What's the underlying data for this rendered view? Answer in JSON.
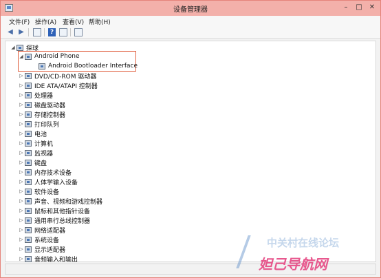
{
  "window": {
    "title": "设备管理器",
    "controls": [
      "–",
      "□",
      "✕"
    ]
  },
  "menu": [
    "文件(F)",
    "操作(A)",
    "查看(V)",
    "帮助(H)"
  ],
  "toolbar": {
    "buttons": [
      "back-icon",
      "forward-icon",
      "properties-icon",
      "help-icon",
      "console-icon",
      "scan-icon"
    ]
  },
  "tree": {
    "root": "探球",
    "highlighted": "Android Phone",
    "items": [
      {
        "label": "Android Phone",
        "expanded": true,
        "indent": 0
      },
      {
        "label": "Android Bootloader Interface",
        "expanded": false,
        "indent": 1,
        "leaf": true
      },
      {
        "label": "DVD/CD-ROM 驱动器"
      },
      {
        "label": "IDE ATA/ATAPI 控制器"
      },
      {
        "label": "处理器"
      },
      {
        "label": "磁盘驱动器"
      },
      {
        "label": "存储控制器"
      },
      {
        "label": "打印队列"
      },
      {
        "label": "电池"
      },
      {
        "label": "计算机"
      },
      {
        "label": "监视器"
      },
      {
        "label": "键盘"
      },
      {
        "label": "内存技术设备"
      },
      {
        "label": "人体学输入设备"
      },
      {
        "label": "软件设备"
      },
      {
        "label": "声音、视频和游戏控制器"
      },
      {
        "label": "鼠标和其他指针设备"
      },
      {
        "label": "通用串行总线控制器"
      },
      {
        "label": "网络适配器"
      },
      {
        "label": "系统设备"
      },
      {
        "label": "显示适配器"
      },
      {
        "label": "音频输入和输出"
      }
    ]
  },
  "watermark": {
    "top": "中关村在线论坛",
    "bottom": "妲己导航网"
  },
  "colors": {
    "titlebar": "#f3b0aa",
    "highlight_border": "#e06040"
  }
}
